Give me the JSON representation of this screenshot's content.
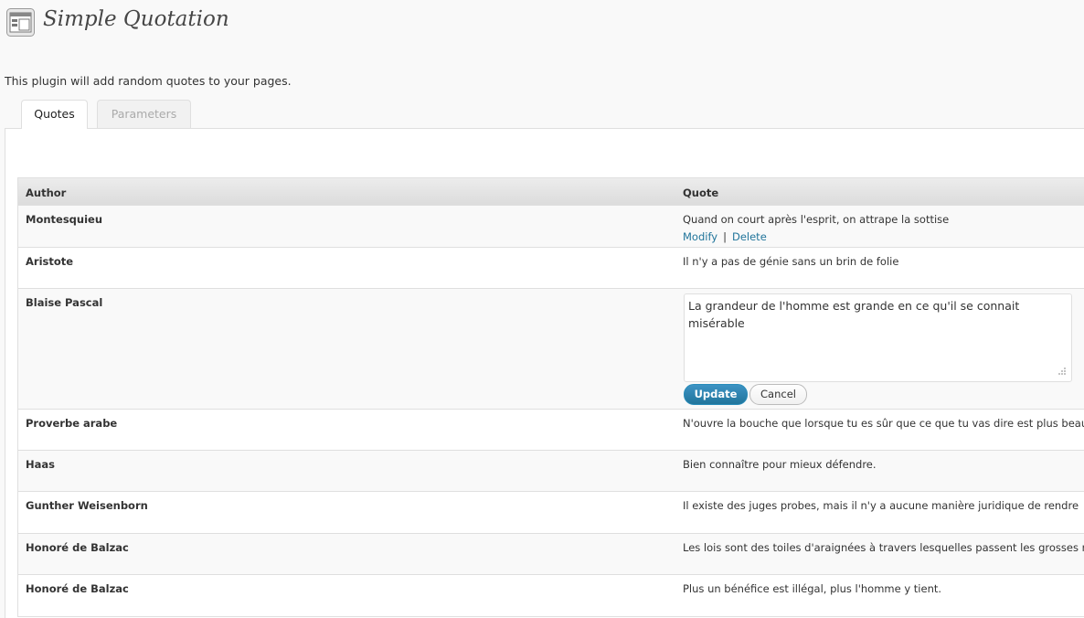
{
  "header": {
    "icon": "settings-page-icon",
    "title": "Simple Quotation",
    "intro": "This plugin will add random quotes to your pages."
  },
  "tabs": [
    {
      "label": "Quotes",
      "active": true
    },
    {
      "label": "Parameters",
      "active": false
    }
  ],
  "table": {
    "columns": {
      "author": "Author",
      "quote": "Quote"
    },
    "rows": [
      {
        "author": "Montesquieu",
        "quote": "Quand on court après l'esprit, on attrape la sottise",
        "modify": "Modify",
        "separator": "|",
        "delete": "Delete"
      },
      {
        "author": "Aristote",
        "quote": "Il n'y a pas de génie sans un brin de folie"
      },
      {
        "author": "Blaise Pascal",
        "edit_value": "La grandeur de l'homme est grande en ce qu'il se connait misérable",
        "update": "Update",
        "cancel": "Cancel"
      },
      {
        "author": "Proverbe arabe",
        "quote": "N'ouvre la bouche que lorsque tu es sûr que ce que tu vas dire est plus beau"
      },
      {
        "author": "Haas",
        "quote": "Bien connaître pour mieux défendre."
      },
      {
        "author": "Gunther Weisenborn",
        "quote": "Il existe des juges probes, mais il n'y a aucune manière juridique de rendre"
      },
      {
        "author": "Honoré de Balzac",
        "quote": "Les lois sont des toiles d'araignées à travers lesquelles passent les grosses m"
      },
      {
        "author": "Honoré de Balzac",
        "quote": "Plus un bénéfice est illégal, plus l'homme y tient."
      }
    ]
  },
  "colors": {
    "link": "#21759b",
    "primary_button": "#21759b",
    "border": "#dfdfdf"
  }
}
